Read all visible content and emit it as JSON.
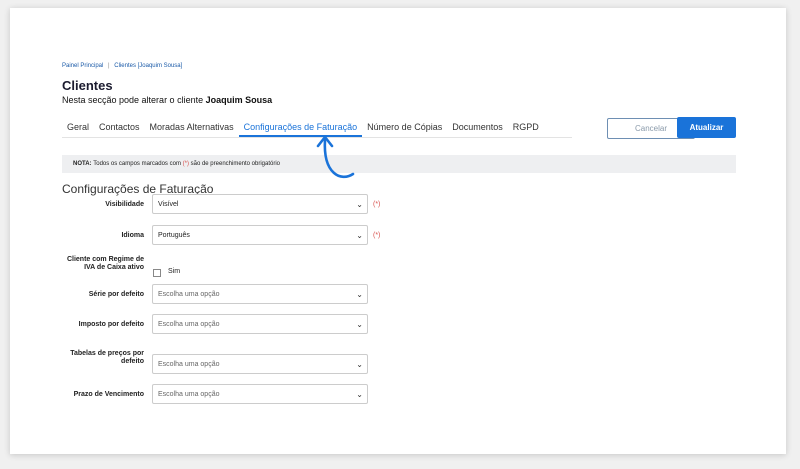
{
  "breadcrumb": {
    "home": "Painel Principal",
    "separator": "|",
    "current": "Clientes [Joaquim Sousa]"
  },
  "page": {
    "title": "Clientes",
    "subtitle_prefix": "Nesta secção pode alterar o cliente",
    "client_name": "Joaquim Sousa"
  },
  "tabs": [
    {
      "label": "Geral"
    },
    {
      "label": "Contactos"
    },
    {
      "label": "Moradas Alternativas"
    },
    {
      "label": "Configurações de Faturação",
      "active": true
    },
    {
      "label": "Número de Cópias"
    },
    {
      "label": "Documentos"
    },
    {
      "label": "RGPD"
    }
  ],
  "actions": {
    "cancel": "Cancelar",
    "update": "Atualizar"
  },
  "note": {
    "prefix": "NOTA:",
    "text1": "Todos os campos marcados com",
    "mark": "(*)",
    "text2": "são de preenchimento obrigatório"
  },
  "section_title": "Configurações de Faturação",
  "form": {
    "visibilidade": {
      "label": "Visibilidade",
      "value": "Visível",
      "required": "(*)"
    },
    "idioma": {
      "label": "Idioma",
      "value": "Português",
      "required": "(*)"
    },
    "iva_caixa": {
      "label": "Cliente com Regime de IVA de Caixa ativo",
      "option": "Sim",
      "checked": false
    },
    "serie": {
      "label": "Série por defeito",
      "placeholder": "Escolha uma opção"
    },
    "imposto": {
      "label": "Imposto por defeito",
      "placeholder": "Escolha uma opção"
    },
    "tabelas": {
      "label": "Tabelas de preços por defeito",
      "placeholder": "Escolha uma opção"
    },
    "prazo": {
      "label": "Prazo de Vencimento",
      "placeholder": "Escolha uma opção"
    }
  },
  "icons": {
    "select_chevron": "chevron-down-icon",
    "pointer_arrow": "curved-arrow-icon"
  },
  "colors": {
    "accent": "#1a73d9",
    "required": "#d9534f"
  }
}
